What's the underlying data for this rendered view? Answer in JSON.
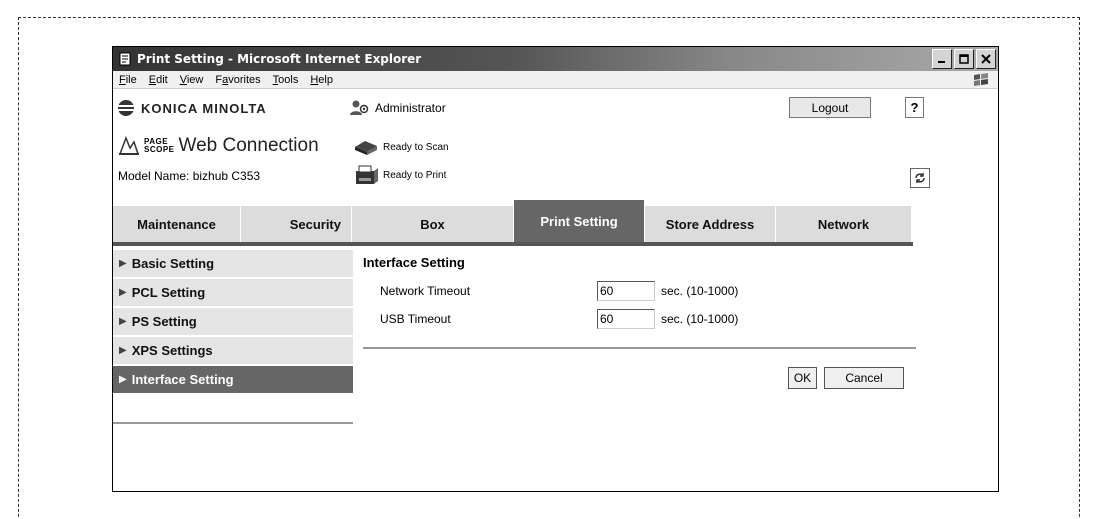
{
  "window": {
    "title": "Print Setting - Microsoft Internet Explorer",
    "minimize_icon": "minimize-icon",
    "maximize_icon": "maximize-icon",
    "close_icon": "close-icon"
  },
  "menubar": {
    "items": [
      {
        "label": "File",
        "underline": "F",
        "rest": "ile"
      },
      {
        "label": "Edit",
        "underline": "E",
        "rest": "dit"
      },
      {
        "label": "View",
        "underline": "V",
        "rest": "iew"
      },
      {
        "label": "Favorites",
        "underline": "a",
        "pre": "F",
        "rest": "vorites"
      },
      {
        "label": "Tools",
        "underline": "T",
        "rest": "ools"
      },
      {
        "label": "Help",
        "underline": "H",
        "rest": "elp"
      }
    ]
  },
  "header": {
    "brand": "KONICA MINOLTA",
    "user": "Administrator",
    "logout_label": "Logout",
    "help_label": "?",
    "pagescope_small_top": "PAGE",
    "pagescope_small_bottom": "SCOPE",
    "web_connection": "Web Connection",
    "model_name": "Model Name: bizhub C353",
    "scan_status": "Ready to Scan",
    "print_status": "Ready to Print"
  },
  "tabs": [
    {
      "label": "Maintenance",
      "active": false
    },
    {
      "label": "Security",
      "active": false
    },
    {
      "label": "Box",
      "active": false
    },
    {
      "label": "Print Setting",
      "active": true
    },
    {
      "label": "Store Address",
      "active": false
    },
    {
      "label": "Network",
      "active": false
    }
  ],
  "sidebar": {
    "items": [
      {
        "label": "Basic Setting",
        "active": false
      },
      {
        "label": "PCL Setting",
        "active": false
      },
      {
        "label": "PS Setting",
        "active": false
      },
      {
        "label": "XPS Settings",
        "active": false
      },
      {
        "label": "Interface Setting",
        "active": true
      }
    ]
  },
  "main": {
    "title": "Interface Setting",
    "fields": [
      {
        "label": "Network Timeout",
        "value": "60",
        "unit": "sec. (10-1000)"
      },
      {
        "label": "USB Timeout",
        "value": "60",
        "unit": "sec. (10-1000)"
      }
    ],
    "ok_label": "OK",
    "cancel_label": "Cancel"
  },
  "colors": {
    "active_tab": "#666666",
    "inactive_tab": "#dcdcdc"
  }
}
